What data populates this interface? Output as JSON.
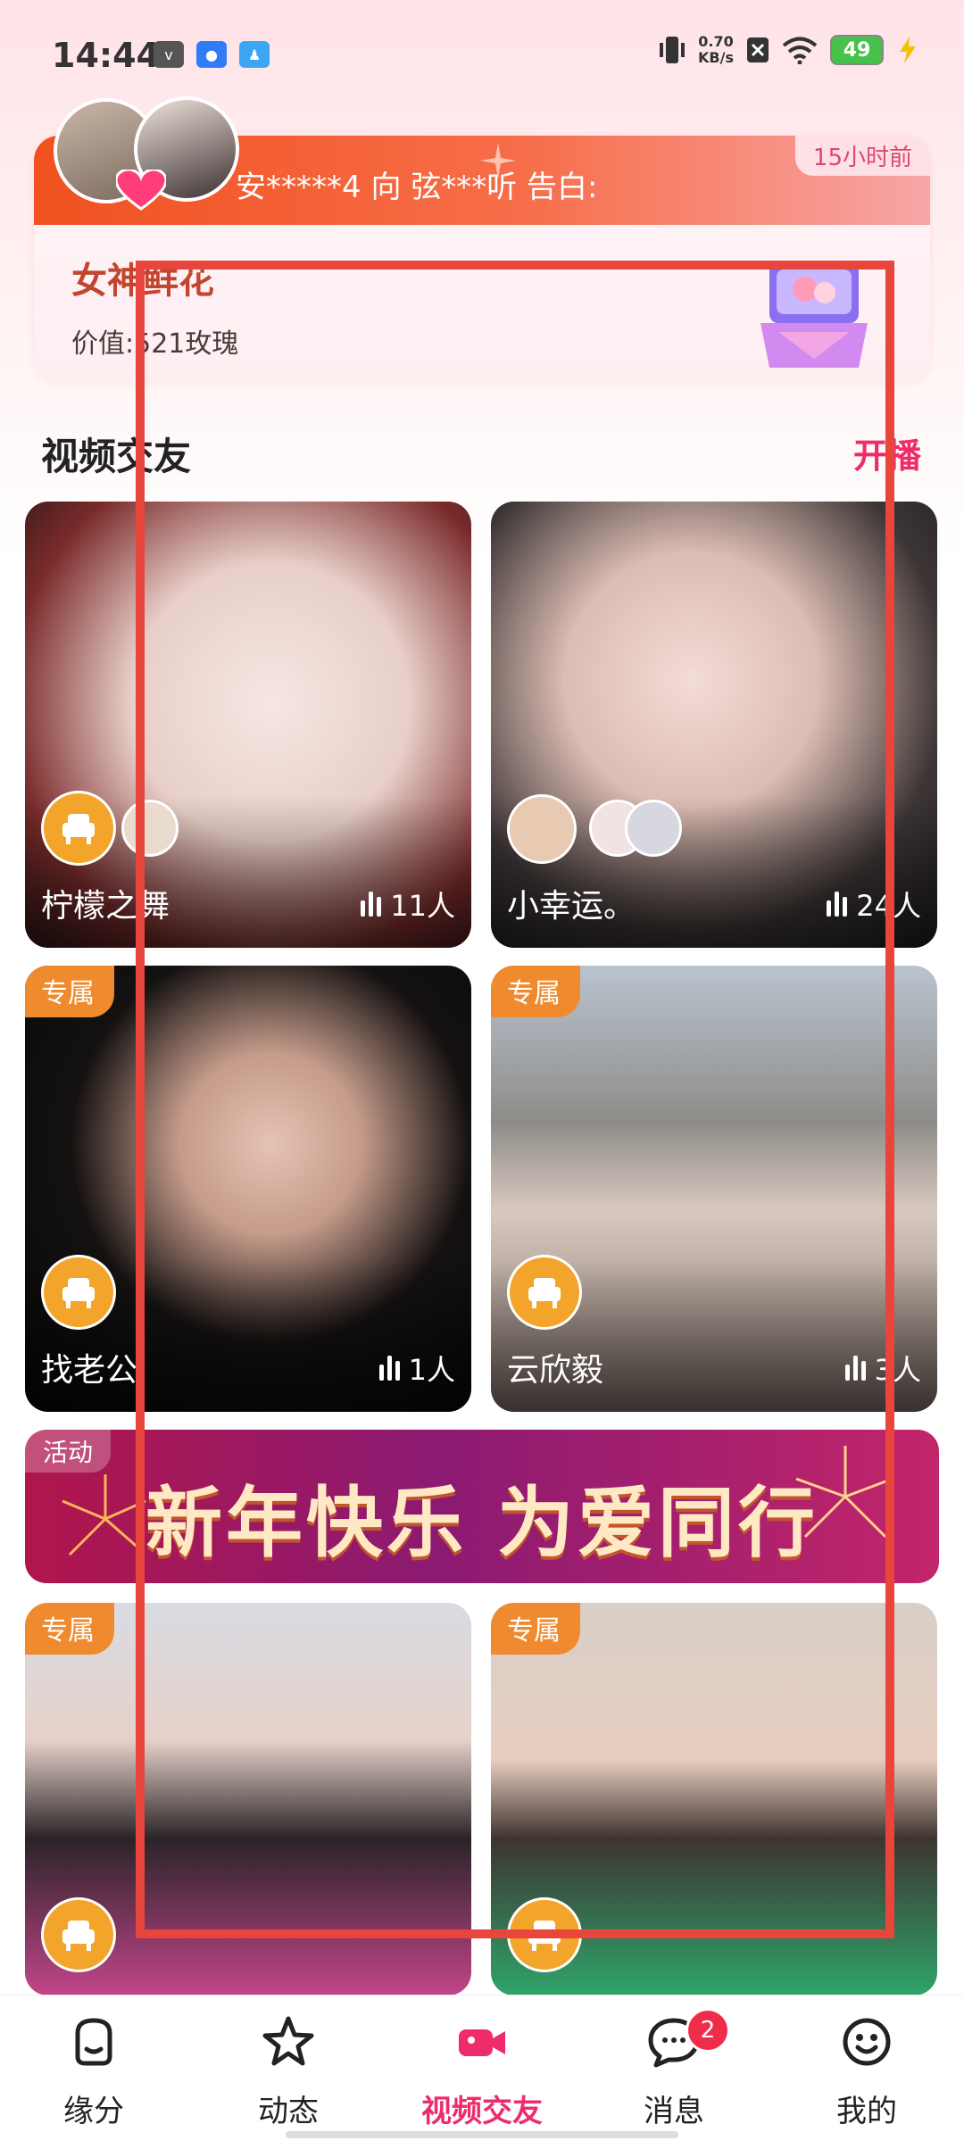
{
  "status_bar": {
    "time": "14:44",
    "speed_value": "0.70",
    "speed_unit": "KB/s",
    "battery": "49"
  },
  "confession": {
    "message": "安*****4 向 弦***听 告白:",
    "time_ago": "15小时前",
    "gift_name": "女神鲜花",
    "gift_value": "价值:521玫瑰"
  },
  "section": {
    "title": "视频交友",
    "start_live": "开播"
  },
  "rooms": [
    {
      "name": "柠檬之舞",
      "count": "11人",
      "tag": ""
    },
    {
      "name": "小幸运。",
      "count": "24人",
      "tag": ""
    },
    {
      "name": "找老公",
      "count": "1人",
      "tag": "专属"
    },
    {
      "name": "云欣毅",
      "count": "3人",
      "tag": "专属"
    },
    {
      "name": "",
      "count": "",
      "tag": "专属"
    },
    {
      "name": "",
      "count": "",
      "tag": "专属"
    }
  ],
  "event_banner": {
    "tag": "活动",
    "title": "新年快乐 为爱同行"
  },
  "tabbar": {
    "items": [
      {
        "label": "缘分",
        "icon": "smile-bag-icon"
      },
      {
        "label": "动态",
        "icon": "star-icon"
      },
      {
        "label": "视频交友",
        "icon": "video-camera-icon"
      },
      {
        "label": "消息",
        "icon": "chat-bubble-icon"
      },
      {
        "label": "我的",
        "icon": "smiley-face-icon"
      }
    ],
    "message_badge": "2",
    "active_index": 2
  },
  "colors": {
    "accent": "#ef2c6a",
    "tag": "#f08a2e",
    "highlight": "#e8453d"
  }
}
